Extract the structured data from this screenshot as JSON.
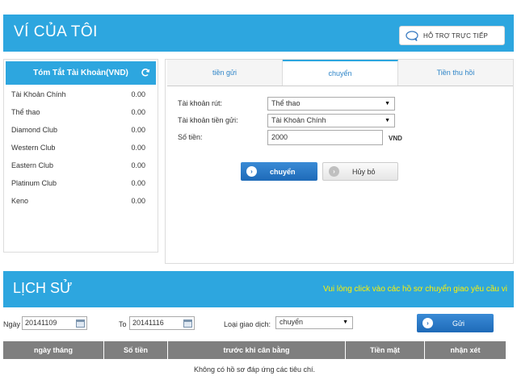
{
  "header": {
    "title": "VÍ CỦA TÔI",
    "support_label": "HỖ TRỢ TRỰC TIẾP"
  },
  "summary": {
    "title": "Tóm Tắt Tài Khoản(VND)",
    "accounts": [
      {
        "name": "Tài Khoản Chính",
        "balance": "0.00"
      },
      {
        "name": "Thể thao",
        "balance": "0.00"
      },
      {
        "name": "Diamond Club",
        "balance": "0.00"
      },
      {
        "name": "Western Club",
        "balance": "0.00"
      },
      {
        "name": "Eastern Club",
        "balance": "0.00"
      },
      {
        "name": "Platinum Club",
        "balance": "0.00"
      },
      {
        "name": "Keno",
        "balance": "0.00"
      }
    ]
  },
  "tabs": [
    {
      "label": "tiền gửi",
      "active": false
    },
    {
      "label": "chuyển",
      "active": true
    },
    {
      "label": "Tiền thu hồi",
      "active": false
    }
  ],
  "transfer_form": {
    "from_label": "Tài khoản rút:",
    "from_value": "Thể thao",
    "to_label": "Tài khoản tiền gửi:",
    "to_value": "Tài Khoản Chính",
    "amount_label": "Số tiền:",
    "amount_value": "2000",
    "currency": "VND",
    "submit_label": "chuyển",
    "cancel_label": "Hủy bỏ"
  },
  "history": {
    "title": "LỊCH SỬ",
    "hint": "Vui lòng click vào các hồ sơ chuyển giao yêu cầu vi",
    "from_label": "Ngày",
    "from_date": "20141109",
    "to_label": "To",
    "to_date": "20141116",
    "type_label": "Loại giao dịch:",
    "type_value": "chuyển",
    "send_label": "Gửi",
    "columns": [
      "ngày tháng",
      "Số tiền",
      "trước khi cân bằng",
      "Tiền mặt",
      "nhận xét"
    ],
    "empty_text": "Không có hồ sơ đáp ứng các tiêu chí."
  },
  "colors": {
    "accent": "#2da6df",
    "button_blue": "#1e6ab8",
    "hint_yellow": "#fff200",
    "table_header": "#7f7f7f"
  }
}
